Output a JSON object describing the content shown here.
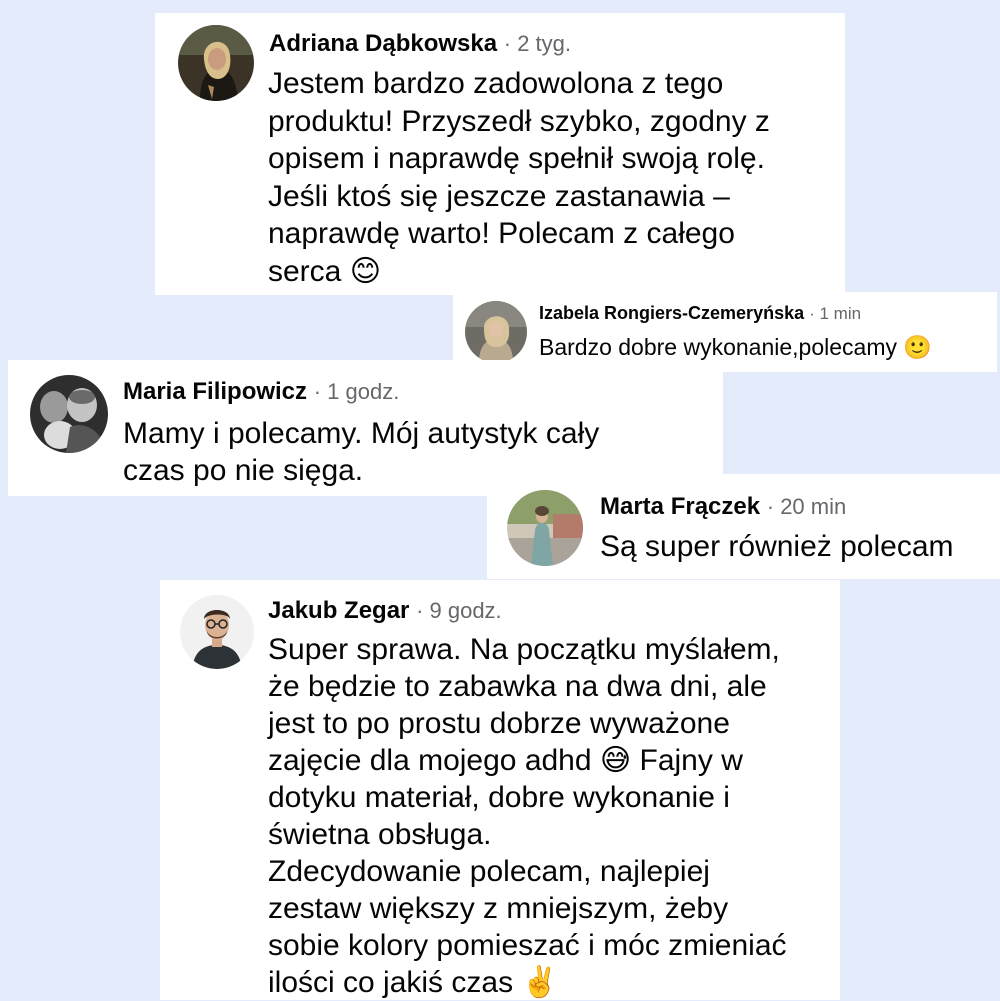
{
  "comments": [
    {
      "author": "Adriana Dąbkowska",
      "time": "· 2 tyg.",
      "text": "Jestem bardzo zadowolona z tego\nproduktu! Przyszedł szybko, zgodny z\nopisem i naprawdę spełnił swoją rolę.\nJeśli ktoś się jeszcze zastanawia –\nnaprawdę warto! Polecam z całego\nserca 😊",
      "avatar_icon": "woman-portrait-avatar"
    },
    {
      "author": "Izabela Rongiers-Czemeryńska",
      "time": "· 1 min",
      "text": "Bardzo dobre wykonanie,polecamy 🙂",
      "avatar_icon": "woman-portrait-avatar"
    },
    {
      "author": "Maria Filipowicz",
      "time": "· 1 godz.",
      "text": "Mamy i polecamy. Mój autystyk cały\nczas po nie sięga.",
      "avatar_icon": "family-photo-avatar"
    },
    {
      "author": "Marta Frączek",
      "time": "· 20 min",
      "text": "Są super również polecam",
      "avatar_icon": "outdoor-photo-avatar"
    },
    {
      "author": "Jakub Zegar",
      "time": "· 9 godz.",
      "text": "Super sprawa. Na początku myślałem,\nże będzie to zabawka na dwa dni, ale\njest to po prostu dobrze wyważone\nzajęcie dla mojego adhd 😅 Fajny w\ndotyku materiał, dobre wykonanie i\nświetna obsługa.\nZdecydowanie polecam, najlepiej\nzestaw większy z mniejszym, żeby\nsobie kolory pomieszać i móc zmieniać\nilości co jakiś czas ✌️",
      "avatar_icon": "man-glasses-avatar"
    }
  ],
  "colors": {
    "background": "#e4ecfb",
    "card": "#ffffff",
    "name": "#050505",
    "timestamp": "#65676b"
  }
}
